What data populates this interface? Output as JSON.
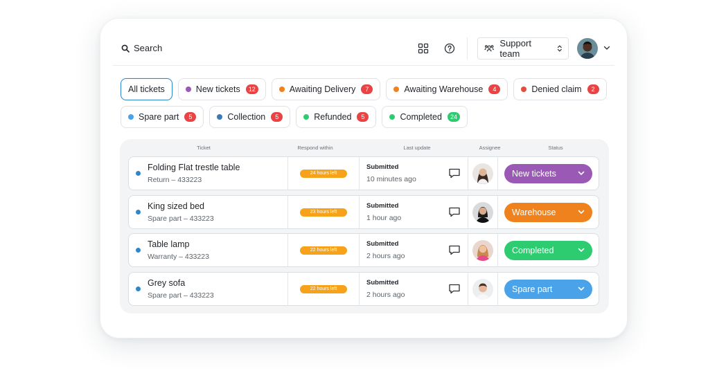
{
  "header": {
    "search_label": "Search",
    "team_label": "Support team"
  },
  "filters": [
    {
      "label": "All tickets",
      "count": null,
      "dot": null,
      "active": true
    },
    {
      "label": "New tickets",
      "count": "12",
      "dot": "#9b59b6"
    },
    {
      "label": "Awaiting Delivery",
      "count": "7",
      "dot": "#f0821e"
    },
    {
      "label": "Awaiting Warehouse",
      "count": "4",
      "dot": "#f0821e"
    },
    {
      "label": "Denied claim",
      "count": "2",
      "dot": "#e74c3c"
    },
    {
      "label": "Spare part",
      "count": "5",
      "dot": "#4aa3e8"
    },
    {
      "label": "Collection",
      "count": "5",
      "dot": "#3b7bb5"
    },
    {
      "label": "Refunded",
      "count": "5",
      "dot": "#2ecc71"
    },
    {
      "label": "Completed",
      "count": "24",
      "dot": "#2ecc71",
      "badge_color": "green"
    }
  ],
  "columns": {
    "ticket": "Ticket",
    "respond": "Respond within",
    "update": "Last update",
    "assignee": "Assignee",
    "status": "Status"
  },
  "rows": [
    {
      "title": "Folding Flat trestle table",
      "sub": "Return – 433223",
      "respond": "24 hours left",
      "update_status": "Submitted",
      "update_time": "10 minutes ago",
      "status": "New tickets",
      "status_color": "#9b59b6"
    },
    {
      "title": "King sized bed",
      "sub": "Spare part – 433223",
      "respond": "23 hours left",
      "update_status": "Submitted",
      "update_time": "1 hour ago",
      "status": "Warehouse",
      "status_color": "#f0821e"
    },
    {
      "title": "Table lamp",
      "sub": "Warranty – 433223",
      "respond": "22 hours left",
      "update_status": "Submitted",
      "update_time": "2 hours ago",
      "status": "Completed",
      "status_color": "#2ecc71"
    },
    {
      "title": "Grey sofa",
      "sub": "Spare part – 433223",
      "respond": "22 hours left",
      "update_status": "Submitted",
      "update_time": "2 hours ago",
      "status": "Spare part",
      "status_color": "#4aa3e8"
    }
  ]
}
